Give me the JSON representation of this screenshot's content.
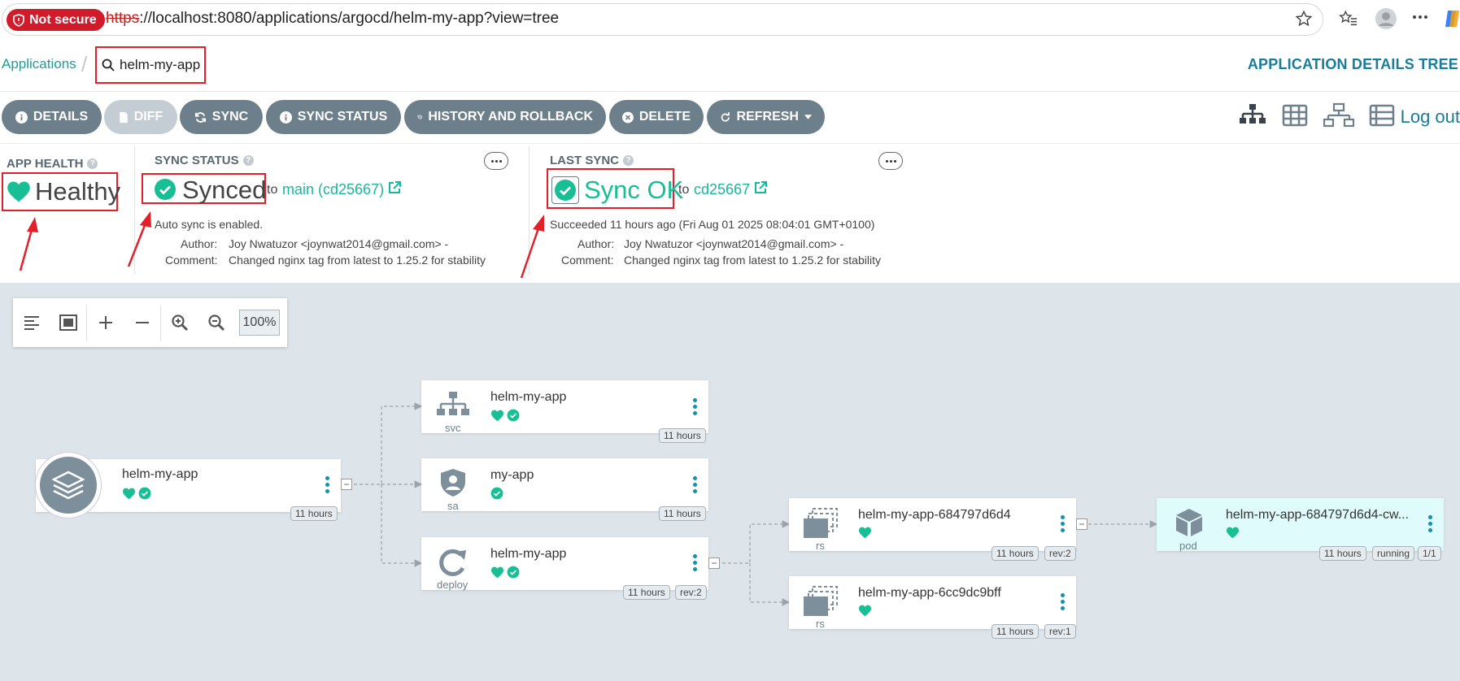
{
  "browser": {
    "security_label": "Not secure",
    "url_protocol": "https",
    "url_rest": "://localhost:8080/applications/argocd/helm-my-app?view=tree"
  },
  "breadcrumb": {
    "applications": "Applications",
    "separator": "/",
    "search_value": "helm-my-app"
  },
  "page_title": "APPLICATION DETAILS TREE",
  "toolbar": {
    "details": "DETAILS",
    "diff": "DIFF",
    "sync": "SYNC",
    "sync_status": "SYNC STATUS",
    "history": "HISTORY AND ROLLBACK",
    "delete": "DELETE",
    "refresh": "REFRESH",
    "logout": "Log out"
  },
  "app_health": {
    "title": "APP HEALTH",
    "status": "Healthy"
  },
  "sync_status": {
    "title": "SYNC STATUS",
    "status": "Synced",
    "to": "to",
    "revision": "main (cd25667)",
    "auto_sync": "Auto sync is enabled.",
    "author_label": "Author:",
    "author": "Joy Nwatuzor <joynwat2014@gmail.com> -",
    "comment_label": "Comment:",
    "comment": "Changed nginx tag from latest to 1.25.2 for stability"
  },
  "last_sync": {
    "title": "LAST SYNC",
    "status": "Sync OK",
    "to": "to",
    "revision": "cd25667",
    "result": "Succeeded 11 hours ago (Fri Aug 01 2025 08:04:01 GMT+0100)",
    "author_label": "Author:",
    "author": "Joy Nwatuzor <joynwat2014@gmail.com> -",
    "comment_label": "Comment:",
    "comment": "Changed nginx tag from latest to 1.25.2 for stability"
  },
  "zoom": {
    "level": "100%"
  },
  "nodes": {
    "app": {
      "name": "helm-my-app",
      "age": "11 hours"
    },
    "svc": {
      "name": "helm-my-app",
      "kind": "svc",
      "age": "11 hours"
    },
    "sa": {
      "name": "my-app",
      "kind": "sa",
      "age": "11 hours"
    },
    "deploy": {
      "name": "helm-my-app",
      "kind": "deploy",
      "age": "11 hours",
      "rev": "rev:2"
    },
    "rs1": {
      "name": "helm-my-app-684797d6d4",
      "kind": "rs",
      "age": "11 hours",
      "rev": "rev:2"
    },
    "rs2": {
      "name": "helm-my-app-6cc9dc9bff",
      "kind": "rs",
      "age": "11 hours",
      "rev": "rev:1"
    },
    "pod": {
      "name": "helm-my-app-684797d6d4-cw...",
      "kind": "pod",
      "age": "11 hours",
      "state": "running",
      "ready": "1/1"
    }
  },
  "colors": {
    "healthy": "#18be94",
    "accent": "#1a7b9a",
    "toolbar": "#6d7f8b",
    "annotation": "#e2202a"
  }
}
